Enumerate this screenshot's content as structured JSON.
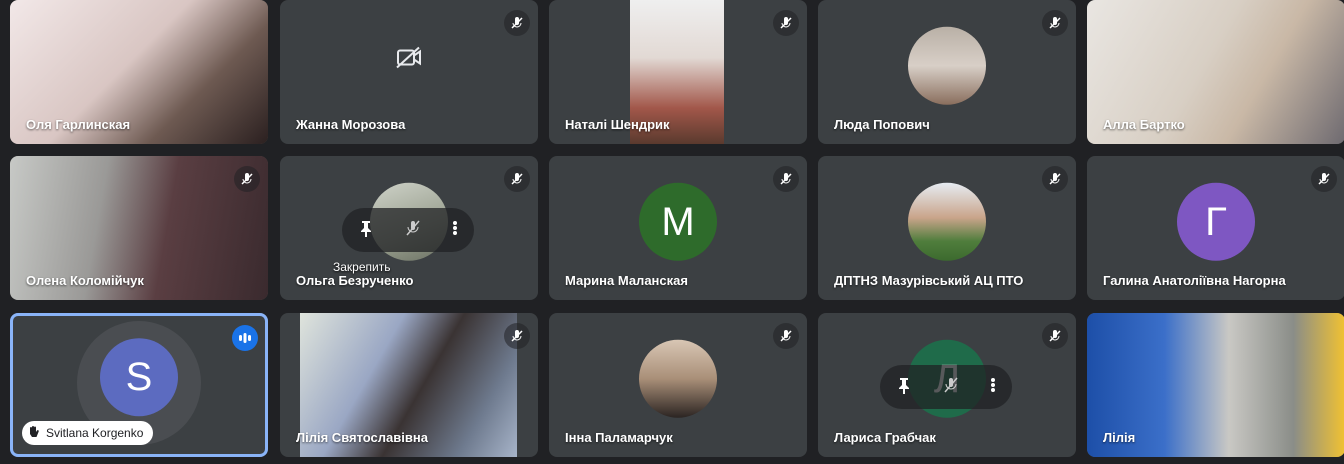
{
  "participants": [
    {
      "name": "Оля Гарлинская"
    },
    {
      "name": "Жанна Морозова"
    },
    {
      "name": "Наталі Шендрик"
    },
    {
      "name": "Люда Попович"
    },
    {
      "name": "Алла Бартко"
    },
    {
      "name": "Олена Коломійчук"
    },
    {
      "name": "Ольга Безрученко"
    },
    {
      "name": "Марина Маланская",
      "initial": "M"
    },
    {
      "name": "ДПТНЗ Мазурівський АЦ ПТО"
    },
    {
      "name": "Галина Анатоліївна Нагорна",
      "initial": "Г"
    },
    {
      "name": "Svitlana Korgenko",
      "initial": "S"
    },
    {
      "name": "Лілія Святославівна"
    },
    {
      "name": "Інна Паламарчук"
    },
    {
      "name": "Лариса Грабчак",
      "initial": "Л"
    },
    {
      "name": "Лілія"
    }
  ],
  "tooltip": "Закрепить",
  "colors": {
    "background": "#202124",
    "tile": "#3c4043",
    "avatar_green": "#2e6b2b",
    "avatar_purple": "#7e57c2",
    "avatar_blue": "#5c6bc0",
    "selection": "#8ab4f8",
    "speaking": "#1a73e8"
  },
  "icons": {
    "muted": "mic-off-icon",
    "camera_off": "camera-off-icon",
    "pin": "pin-icon",
    "more": "more-vert-icon",
    "speaking": "audio-level-icon",
    "hand": "hand-icon"
  }
}
